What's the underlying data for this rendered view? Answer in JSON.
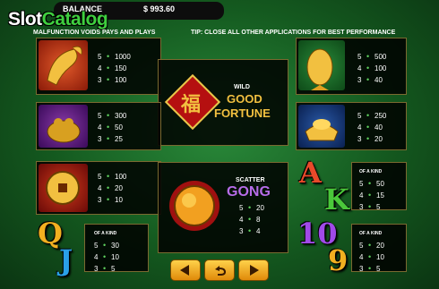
{
  "header": {
    "logo_part1": "Slot",
    "logo_part2": "Catalog",
    "balance_label": "BALANCE",
    "balance_value": "$ 993.60"
  },
  "notices": {
    "left": "MALFUNCTION VOIDS PAYS AND PLAYS",
    "right": "TIP: CLOSE ALL OTHER APPLICATIONS FOR BEST PERFORMANCE"
  },
  "wild": {
    "label": "WILD",
    "line1": "GOOD",
    "line2": "FORTUNE",
    "emblem_char": "福"
  },
  "scatter": {
    "label": "SCATTER",
    "name": "GONG",
    "pays": [
      {
        "count": "5",
        "value": "20"
      },
      {
        "count": "4",
        "value": "8"
      },
      {
        "count": "3",
        "value": "4"
      }
    ]
  },
  "paytables": {
    "koi_left": [
      {
        "count": "5",
        "value": "1000"
      },
      {
        "count": "4",
        "value": "150"
      },
      {
        "count": "3",
        "value": "100"
      }
    ],
    "koi_right": [
      {
        "count": "5",
        "value": "500"
      },
      {
        "count": "4",
        "value": "100"
      },
      {
        "count": "3",
        "value": "40"
      }
    ],
    "toad": [
      {
        "count": "5",
        "value": "300"
      },
      {
        "count": "4",
        "value": "50"
      },
      {
        "count": "3",
        "value": "25"
      }
    ],
    "ingot": [
      {
        "count": "5",
        "value": "250"
      },
      {
        "count": "4",
        "value": "40"
      },
      {
        "count": "3",
        "value": "20"
      }
    ],
    "coin": [
      {
        "count": "5",
        "value": "100"
      },
      {
        "count": "4",
        "value": "20"
      },
      {
        "count": "3",
        "value": "10"
      }
    ],
    "ak": {
      "header": "OF A KIND",
      "rows": [
        {
          "count": "5",
          "value": "50"
        },
        {
          "count": "4",
          "value": "15"
        },
        {
          "count": "3",
          "value": "5"
        }
      ]
    },
    "qj": {
      "header": "OF A KIND",
      "rows": [
        {
          "count": "5",
          "value": "30"
        },
        {
          "count": "4",
          "value": "10"
        },
        {
          "count": "3",
          "value": "5"
        }
      ]
    },
    "ten_nine": {
      "header": "OF A KIND",
      "rows": [
        {
          "count": "5",
          "value": "20"
        },
        {
          "count": "4",
          "value": "10"
        },
        {
          "count": "3",
          "value": "5"
        }
      ]
    }
  },
  "letters": {
    "a": "A",
    "k": "K",
    "q": "Q",
    "j": "J",
    "ten": "10",
    "nine": "9"
  },
  "icons": {
    "prev": "arrow-left-icon",
    "back": "return-icon",
    "next": "arrow-right-icon"
  },
  "colors": {
    "accent_gold": "#e6c84a",
    "scatter_purple": "#b66ce8",
    "felt_green": "#1b6e2a"
  }
}
